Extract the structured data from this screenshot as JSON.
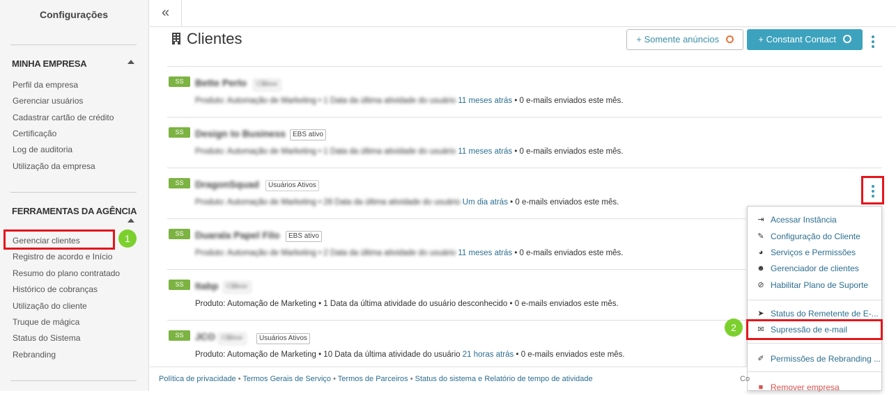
{
  "sidebar": {
    "title": "Configurações",
    "section1": {
      "heading": "MINHA EMPRESA",
      "items": [
        "Perfil da empresa",
        "Gerenciar usuários",
        "Cadastrar cartão de crédito",
        "Certificação",
        "Log de auditoria",
        "Utilização da empresa"
      ]
    },
    "section2": {
      "heading": "FERRAMENTAS DA AGÊNCIA",
      "items": [
        "Gerenciar clientes",
        "Registro de acordo e Início",
        "Resumo do plano contratado",
        "Histórico de cobranças",
        "Utilização do cliente",
        "Truque de mágica",
        "Status do Sistema",
        "Rebranding"
      ]
    }
  },
  "topbar": {
    "collapse_glyph": "«"
  },
  "header": {
    "title": "Clientes",
    "btn_ads": "+  Somente anúncios",
    "btn_cc": "+  Constant Contact"
  },
  "clients": [
    {
      "badge": "SS",
      "name": "Bette Perlo",
      "tag": "CBlnre",
      "meta_pre": "Produto: Automação de Marketing • 1 Data da última atividade do usuário ",
      "meta_link": "11 meses atrás",
      "meta_post": " • 0 e-mails enviados este mês."
    },
    {
      "badge": "SS",
      "name": "Design to Business",
      "tag": "EBS ativo",
      "meta_pre": "Produto: Automação de Marketing • 1 Data da última atividade do usuário ",
      "meta_link": "11 meses atrás",
      "meta_post": " • 0 e-mails enviados este mês."
    },
    {
      "badge": "SS",
      "name": "DragonSquad",
      "tag": "Usuários Ativos",
      "meta_pre": "Produto: Automação de Marketing • 28 Data da última atividade do usuário ",
      "meta_link": "Um dia atrás",
      "meta_post": " • 0 e-mails enviados este mês."
    },
    {
      "badge": "SS",
      "name": "Duarala Papel Filo",
      "tag": "EBS ativo",
      "meta_pre": "Produto: Automação de Marketing • 2 Data da última atividade do usuário ",
      "meta_link": "11 meses atrás",
      "meta_post": " • 0 e-mails enviados este mês."
    },
    {
      "badge": "SS",
      "name": "Itabp",
      "tag": "CBlnre",
      "meta_pre": "Produto: Automação de Marketing • 1 Data da última atividade do usuário desconhecido • 0 e-mails enviados este mês.",
      "meta_link": "",
      "meta_post": ""
    },
    {
      "badge": "SS",
      "name": "JCO",
      "tag": "CBlnre",
      "tag2": "Usuários Ativos",
      "meta_pre": "Produto: Automação de Marketing • 10 Data da última atividade do usuário ",
      "meta_link": "21 horas atrás",
      "meta_post": " • 0 e-mails enviados este mês."
    }
  ],
  "dropdown": {
    "items": [
      {
        "icon": "login-icon",
        "glyph": "⇥",
        "label": "Acessar Instância"
      },
      {
        "icon": "wrench-icon",
        "glyph": "🔧",
        "label": "Configuração do Cliente"
      },
      {
        "icon": "dashboard-icon",
        "glyph": "◕",
        "label": "Serviços e Permissões"
      },
      {
        "icon": "users-icon",
        "glyph": "👥",
        "label": "Gerenciador de clientes"
      },
      {
        "icon": "ban-icon",
        "glyph": "⊘",
        "label": "Habilitar Plano de Suporte"
      },
      {
        "icon": "send-icon",
        "glyph": "➤",
        "label": "Status do Remetente de E-..."
      },
      {
        "icon": "envelope-icon",
        "glyph": "✉",
        "label": "Supressão de e-mail"
      },
      {
        "icon": "brush-icon",
        "glyph": "🖌",
        "label": "Permissões de Rebranding ..."
      },
      {
        "icon": "trash-icon",
        "glyph": "🗑",
        "label": "Remover empresa"
      }
    ]
  },
  "annotations": {
    "step1": "1",
    "step2": "2"
  },
  "footer": {
    "links": [
      "Política de privacidade",
      "Termos Gerais de Serviço",
      "Termos de Parceiros",
      "Status do sistema e Relatório de tempo de atividade"
    ],
    "separator": "•",
    "right": "Co"
  },
  "colors": {
    "accent": "#3da2bd",
    "badge": "#7cb342",
    "annotation_box": "#e4161c",
    "annotation_num": "#7cd02e",
    "link": "#2c6e8f",
    "danger": "#d9534f"
  }
}
